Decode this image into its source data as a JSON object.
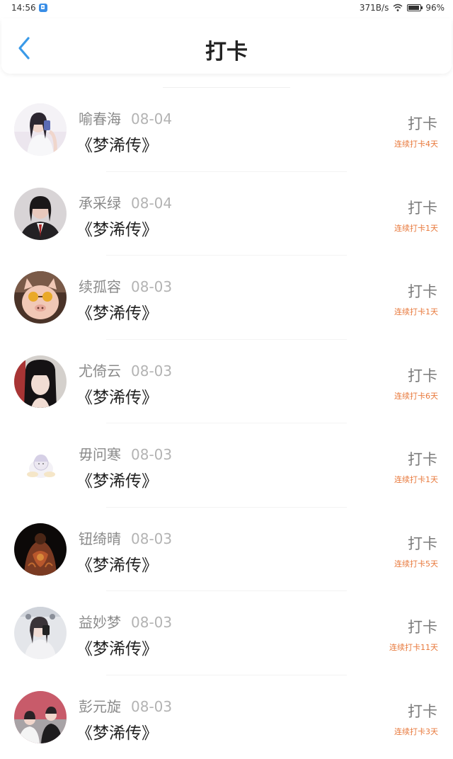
{
  "status_bar": {
    "time": "14:56",
    "network_speed": "371B/s",
    "battery": "96%",
    "icons": [
      "app-notification-icon",
      "wifi-icon",
      "battery-icon"
    ]
  },
  "header": {
    "title": "打卡",
    "back_icon": "chevron-left-icon"
  },
  "colors": {
    "accent": "#3a9ae8",
    "streak": "#e8793c",
    "name": "#8a8a8a",
    "date": "#b3b3b3"
  },
  "checkins": [
    {
      "name": "喻春海",
      "date": "08-04",
      "book": "《梦浠传》",
      "action": "打卡",
      "streak": "连续打卡4天"
    },
    {
      "name": "承采绿",
      "date": "08-04",
      "book": "《梦浠传》",
      "action": "打卡",
      "streak": "连续打卡1天"
    },
    {
      "name": "续孤容",
      "date": "08-03",
      "book": "《梦浠传》",
      "action": "打卡",
      "streak": "连续打卡1天"
    },
    {
      "name": "尤倚云",
      "date": "08-03",
      "book": "《梦浠传》",
      "action": "打卡",
      "streak": "连续打卡6天"
    },
    {
      "name": "毋问寒",
      "date": "08-03",
      "book": "《梦浠传》",
      "action": "打卡",
      "streak": "连续打卡1天"
    },
    {
      "name": "钮绮晴",
      "date": "08-03",
      "book": "《梦浠传》",
      "action": "打卡",
      "streak": "连续打卡5天"
    },
    {
      "name": "益妙梦",
      "date": "08-03",
      "book": "《梦浠传》",
      "action": "打卡",
      "streak": "连续打卡11天"
    },
    {
      "name": "彭元旋",
      "date": "08-03",
      "book": "《梦浠传》",
      "action": "打卡",
      "streak": "连续打卡3天"
    }
  ]
}
